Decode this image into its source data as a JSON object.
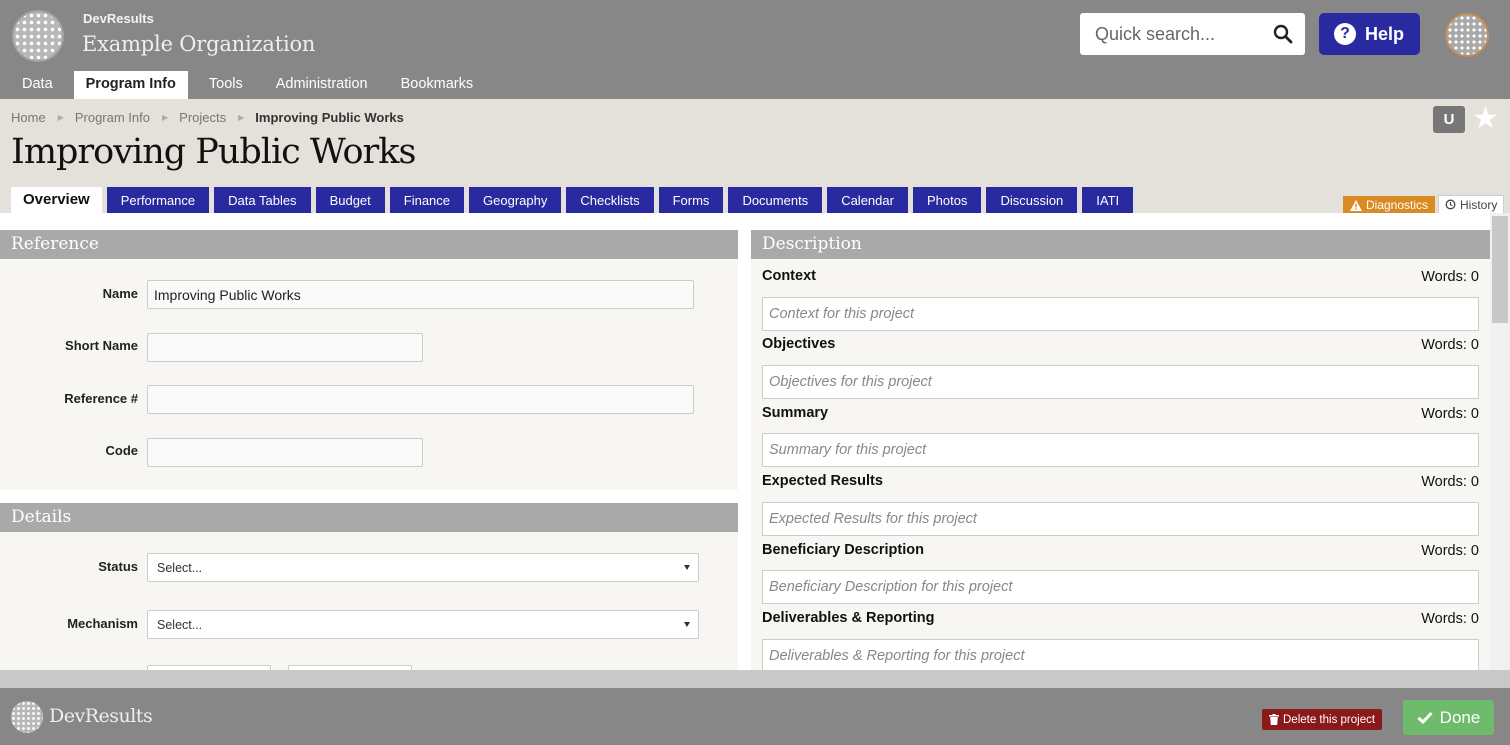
{
  "header": {
    "brand": "DevResults",
    "org_name": "Example Organization",
    "search_placeholder": "Quick search...",
    "help_label": "Help",
    "nav": [
      "Data",
      "Program Info",
      "Tools",
      "Administration",
      "Bookmarks"
    ],
    "nav_active": "Program Info"
  },
  "breadcrumb": {
    "items": [
      "Home",
      "Program Info",
      "Projects"
    ],
    "current": "Improving Public Works"
  },
  "user_badge": "U",
  "page_title": "Improving Public Works",
  "tabs": [
    "Overview",
    "Performance",
    "Data Tables",
    "Budget",
    "Finance",
    "Geography",
    "Checklists",
    "Forms",
    "Documents",
    "Calendar",
    "Photos",
    "Discussion",
    "IATI"
  ],
  "diagnostics_label": "Diagnostics",
  "history_label": "History",
  "reference": {
    "heading": "Reference",
    "name_label": "Name",
    "name_value": "Improving Public Works",
    "short_name_label": "Short Name",
    "reference_label": "Reference #",
    "code_label": "Code"
  },
  "details": {
    "heading": "Details",
    "status_label": "Status",
    "status_value": "Select...",
    "mechanism_label": "Mechanism",
    "mechanism_value": "Select..."
  },
  "description": {
    "heading": "Description",
    "fields": [
      {
        "label": "Context",
        "words": "Words: 0",
        "placeholder": "Context for this project"
      },
      {
        "label": "Objectives",
        "words": "Words: 0",
        "placeholder": "Objectives for this project"
      },
      {
        "label": "Summary",
        "words": "Words: 0",
        "placeholder": "Summary for this project"
      },
      {
        "label": "Expected Results",
        "words": "Words: 0",
        "placeholder": "Expected Results for this project"
      },
      {
        "label": "Beneficiary Description",
        "words": "Words: 0",
        "placeholder": "Beneficiary Description for this project"
      },
      {
        "label": "Deliverables & Reporting",
        "words": "Words: 0",
        "placeholder": "Deliverables & Reporting for this project"
      }
    ]
  },
  "footer": {
    "brand": "DevResults",
    "delete_label": "Delete this project",
    "done_label": "Done"
  },
  "colors": {
    "header_gray": "#878787",
    "tab_blue": "#2a2aa0",
    "diagnostics_orange": "#d98a22",
    "delete_red": "#8a1a1a",
    "done_green": "#6fbb6c"
  }
}
